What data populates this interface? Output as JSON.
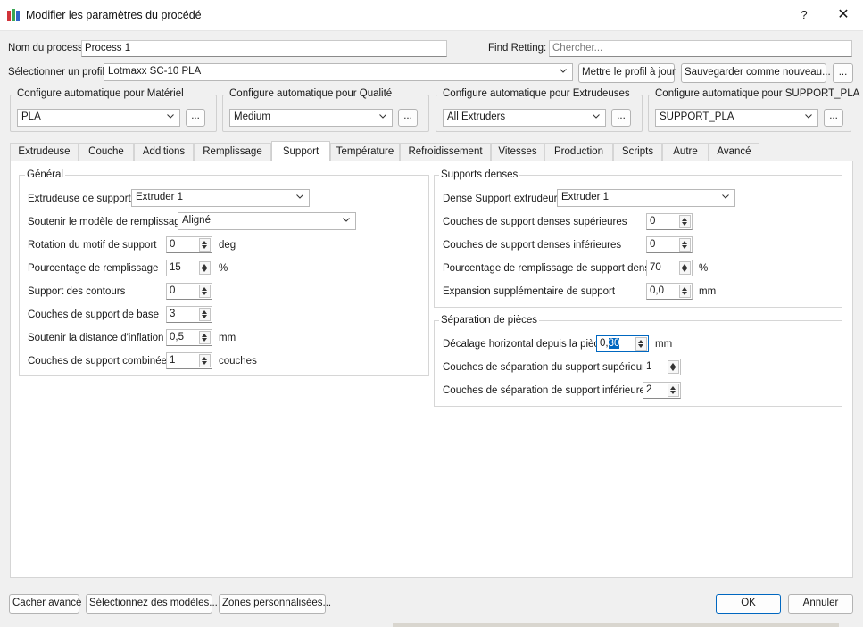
{
  "window": {
    "title": "Modifier les paramètres du procédé",
    "help": "?",
    "close": "✕"
  },
  "top": {
    "process_name_label": "Nom du process",
    "process_name_value": "Process 1",
    "find_label": "Find Retting:",
    "find_placeholder": "Chercher...",
    "profile_label": "Sélectionner un profil",
    "profile_value": "Lotmaxx SC-10 PLA",
    "update_profile": "Mettre le profil à jour",
    "save_new": "Sauvegarder comme nouveau...",
    "more": "..."
  },
  "auto_config": [
    {
      "title": "Configure automatique pour Matériel",
      "value": "PLA",
      "more": "..."
    },
    {
      "title": "Configure automatique pour Qualité",
      "value": "Medium",
      "more": "..."
    },
    {
      "title": "Configure automatique pour Extrudeuses",
      "value": "All Extruders",
      "more": "..."
    },
    {
      "title": "Configure automatique pour SUPPORT_PLA",
      "value": "SUPPORT_PLA",
      "more": "..."
    }
  ],
  "tabs": [
    "Extrudeuse",
    "Couche",
    "Additions",
    "Remplissage",
    "Support",
    "Température",
    "Refroidissement",
    "Vitesses",
    "Production",
    "Scripts",
    "Autre",
    "Avancé"
  ],
  "active_tab": "Support",
  "general": {
    "title": "Général",
    "extruder_label": "Extrudeuse de support",
    "extruder_value": "Extruder 1",
    "infill_model_label": "Soutenir le modèle de remplissage",
    "infill_model_value": "Aligné",
    "rotation_label": "Rotation du motif de support",
    "rotation_value": "0",
    "rotation_unit": "deg",
    "fill_pct_label": "Pourcentage de remplissage",
    "fill_pct_value": "15",
    "fill_pct_unit": "%",
    "perimeters_label": "Support des contours",
    "perimeters_value": "0",
    "base_layers_label": "Couches de support de base",
    "base_layers_value": "3",
    "inflation_label": "Soutenir la distance d'inflation",
    "inflation_value": "0,5",
    "inflation_unit": "mm",
    "combined_label": "Couches de support combinées",
    "combined_value": "1",
    "combined_unit": "couches"
  },
  "dense": {
    "title": "Supports denses",
    "extruder_label": "Dense Support extrudeur",
    "extruder_value": "Extruder 1",
    "top_layers_label": "Couches de support denses supérieures",
    "top_layers_value": "0",
    "bottom_layers_label": "Couches de support denses inférieures",
    "bottom_layers_value": "0",
    "fill_pct_label": "Pourcentage de remplissage de support dense",
    "fill_pct_value": "70",
    "fill_pct_unit": "%",
    "expansion_label": "Expansion supplémentaire de support",
    "expansion_value": "0,0",
    "expansion_unit": "mm"
  },
  "separation": {
    "title": "Séparation de pièces",
    "h_offset_label": "Décalage horizontal depuis la pièce",
    "h_offset_prefix": "0,",
    "h_offset_selected": "30",
    "h_offset_unit": "mm",
    "top_sep_label": "Couches de séparation du support supérieur",
    "top_sep_value": "1",
    "bottom_sep_label": "Couches de séparation de support inférieures",
    "bottom_sep_value": "2"
  },
  "footer": {
    "hide_advanced": "Cacher avancé",
    "select_models": "Sélectionnez des modèles...",
    "custom_zones": "Zones personnalisées...",
    "ok": "OK",
    "cancel": "Annuler"
  },
  "colors": {
    "accent": "#0067c0",
    "icon_red": "#d1343a",
    "icon_green": "#3aa655",
    "icon_blue": "#2f64c9"
  }
}
